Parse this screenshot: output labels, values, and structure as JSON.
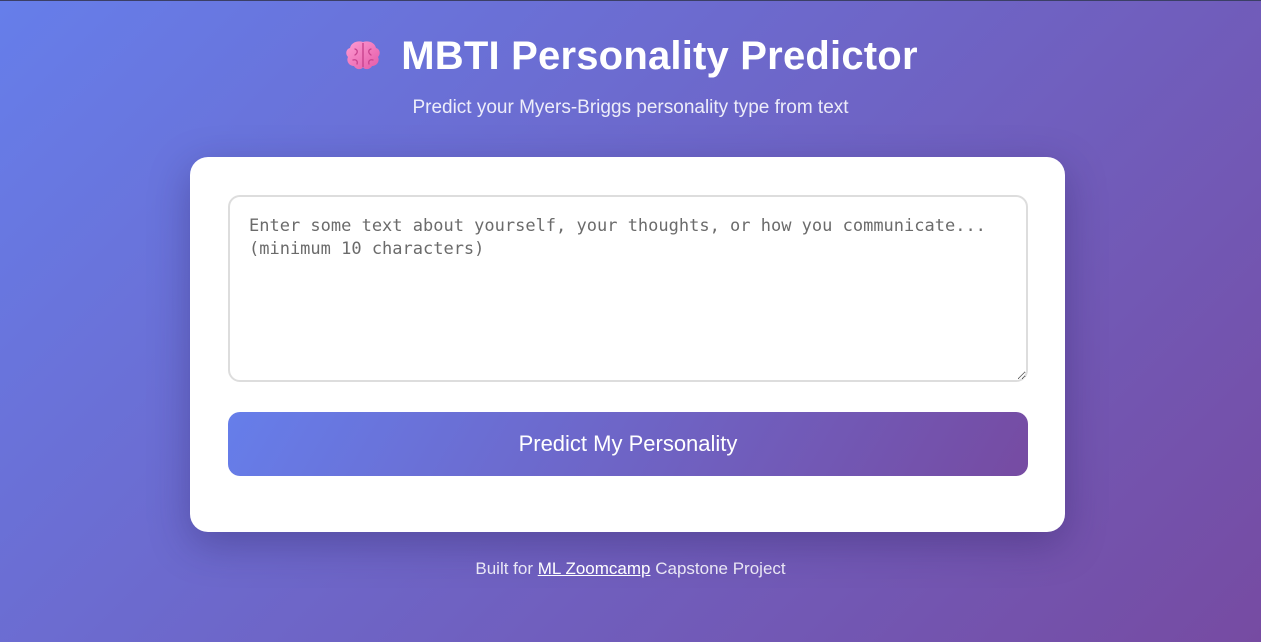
{
  "header": {
    "icon": "brain-icon",
    "title": "MBTI Personality Predictor",
    "subtitle": "Predict your Myers-Briggs personality type from text"
  },
  "form": {
    "textarea_value": "",
    "textarea_placeholder": "Enter some text about yourself, your thoughts, or how you communicate... (minimum 10 characters)",
    "submit_label": "Predict My Personality"
  },
  "footer": {
    "prefix": "Built for",
    "link_text": "ML Zoomcamp",
    "suffix": "Capstone Project"
  },
  "colors": {
    "gradient_start": "#667eea",
    "gradient_end": "#764ba2",
    "card_background": "#ffffff"
  }
}
